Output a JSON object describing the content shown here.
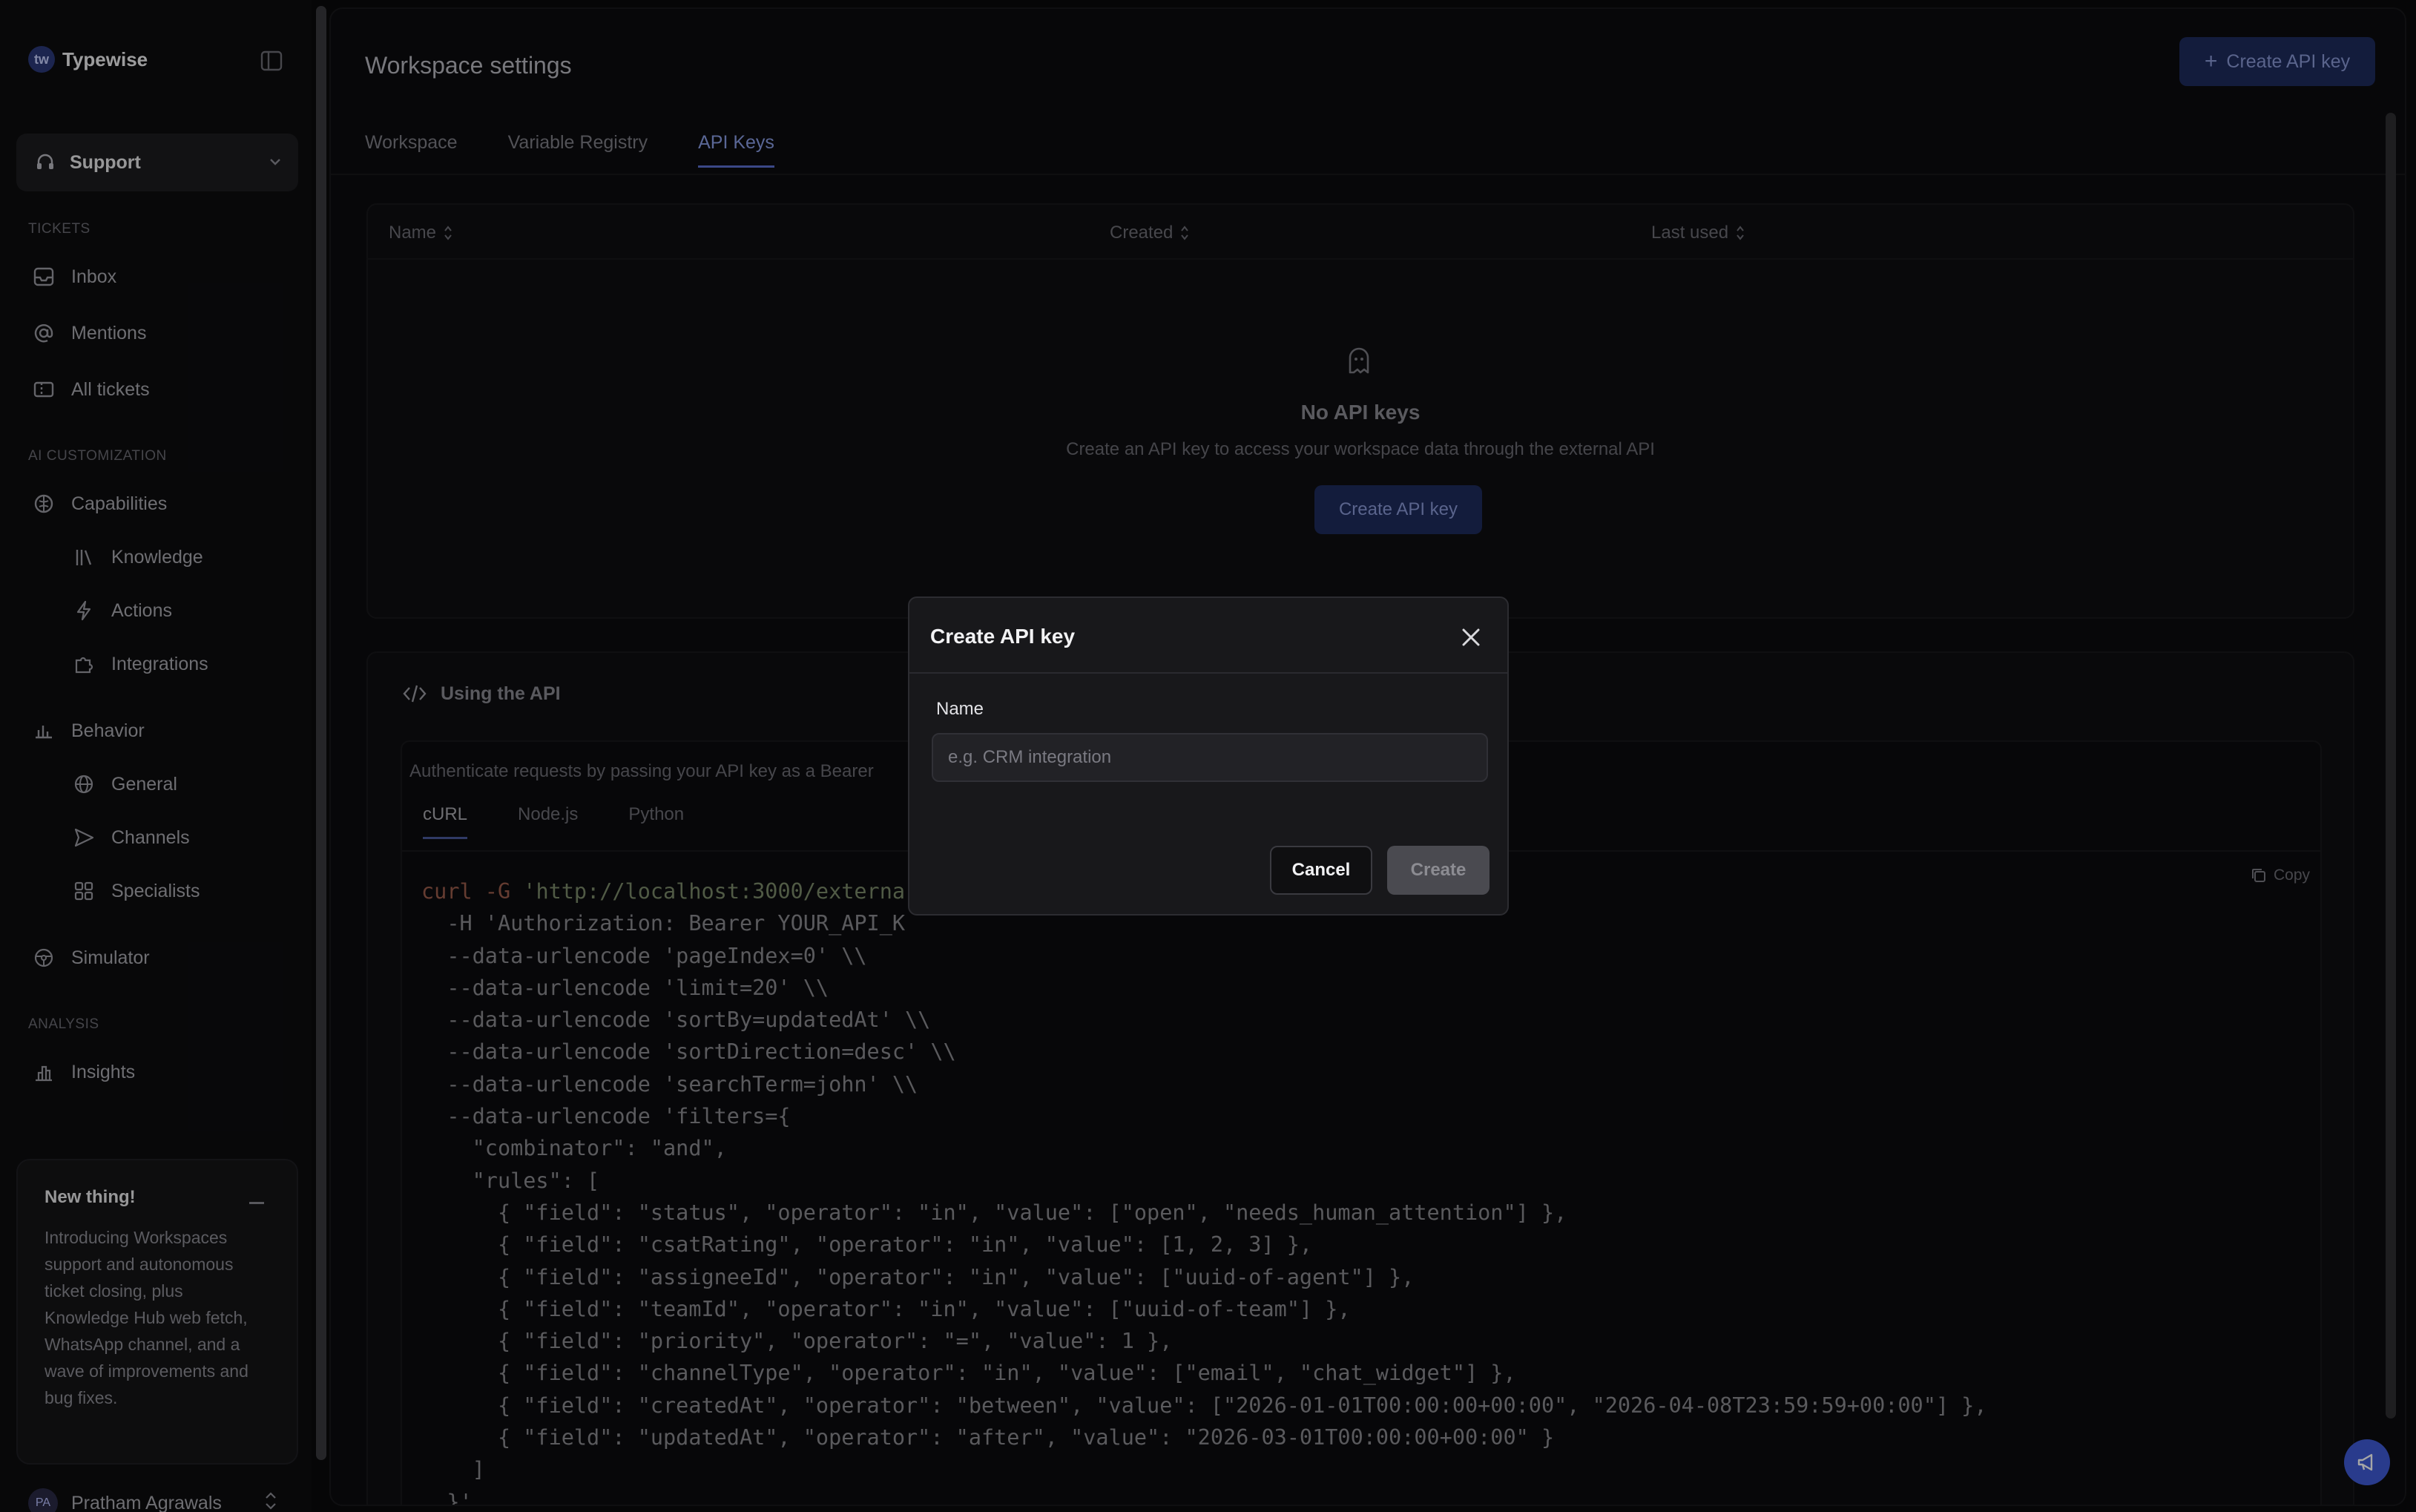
{
  "app": {
    "name": "Typewise",
    "logo_glyph": "tw"
  },
  "sidebar": {
    "team": "Support",
    "sections": {
      "tickets": "TICKETS",
      "ai_customization": "AI CUSTOMIZATION",
      "analysis": "ANALYSIS"
    },
    "items": {
      "inbox": "Inbox",
      "mentions": "Mentions",
      "all_tickets": "All tickets",
      "capabilities": "Capabilities",
      "knowledge": "Knowledge",
      "actions": "Actions",
      "integrations": "Integrations",
      "behavior": "Behavior",
      "general": "General",
      "channels": "Channels",
      "specialists": "Specialists",
      "simulator": "Simulator",
      "insights": "Insights"
    },
    "news": {
      "title": "New thing!",
      "body": "Introducing Workspaces support and autonomous ticket closing, plus Knowledge Hub web fetch, WhatsApp channel, and a wave of improvements and bug fixes."
    },
    "user": {
      "initials": "PA",
      "name": "Pratham Agrawals"
    }
  },
  "header": {
    "title": "Workspace settings",
    "create_button": "Create API key"
  },
  "tabs": {
    "workspace": "Workspace",
    "variable_registry": "Variable Registry",
    "api_keys": "API Keys"
  },
  "keys_table": {
    "columns": {
      "name": "Name",
      "created": "Created",
      "last_used": "Last used"
    },
    "empty_title": "No API keys",
    "empty_subtitle": "Create an API key to access your workspace data through the external API",
    "empty_button": "Create API key"
  },
  "api_section": {
    "title": "Using the API",
    "description": "Authenticate requests by passing your API key as a Bearer",
    "code_tabs": {
      "curl": "cURL",
      "node": "Node.js",
      "python": "Python"
    },
    "copy": "Copy",
    "code": {
      "l1_cmd": "curl -G ",
      "l1_str": "'http://localhost:3000/externa",
      "l2": "  -H 'Authorization: Bearer YOUR_API_K",
      "l3": "  --data-urlencode 'pageIndex=0' \\\\",
      "l4": "  --data-urlencode 'limit=20' \\\\",
      "l5": "  --data-urlencode 'sortBy=updatedAt' \\\\",
      "l6": "  --data-urlencode 'sortDirection=desc' \\\\",
      "l7": "  --data-urlencode 'searchTerm=john' \\\\",
      "l8": "  --data-urlencode 'filters={",
      "l9": "    \"combinator\": \"and\",",
      "l10": "    \"rules\": [",
      "l11": "      { \"field\": \"status\", \"operator\": \"in\", \"value\": [\"open\", \"needs_human_attention\"] },",
      "l12": "      { \"field\": \"csatRating\", \"operator\": \"in\", \"value\": [1, 2, 3] },",
      "l13": "      { \"field\": \"assigneeId\", \"operator\": \"in\", \"value\": [\"uuid-of-agent\"] },",
      "l14": "      { \"field\": \"teamId\", \"operator\": \"in\", \"value\": [\"uuid-of-team\"] },",
      "l15": "      { \"field\": \"priority\", \"operator\": \"=\", \"value\": 1 },",
      "l16": "      { \"field\": \"channelType\", \"operator\": \"in\", \"value\": [\"email\", \"chat_widget\"] },",
      "l17": "      { \"field\": \"createdAt\", \"operator\": \"between\", \"value\": [\"2026-01-01T00:00:00+00:00\", \"2026-04-08T23:59:59+00:00\"] },",
      "l18": "      { \"field\": \"updatedAt\", \"operator\": \"after\", \"value\": \"2026-03-01T00:00:00+00:00\" }",
      "l19": "    ]",
      "l20": "  }'"
    }
  },
  "modal": {
    "title": "Create API key",
    "field_label": "Name",
    "field_placeholder": "e.g. CRM integration",
    "field_value": "",
    "cancel": "Cancel",
    "create": "Create"
  },
  "colors": {
    "accent": "#5b6fcf",
    "primary_button": "#1e2b5c",
    "fab": "#3f5bd8"
  }
}
